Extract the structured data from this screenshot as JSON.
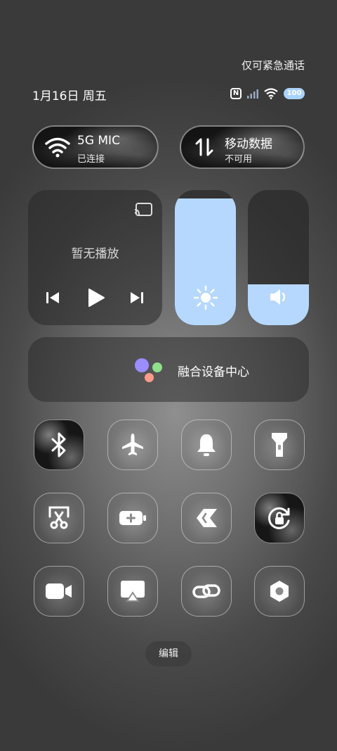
{
  "status": {
    "emergency_text": "仅可紧急通话",
    "date_text": "1月16日 周五",
    "battery_text": "100"
  },
  "wifi_pill": {
    "ssid": "5G MIC",
    "state": "已连接",
    "icon": "wifi-icon"
  },
  "data_pill": {
    "title": "移动数据",
    "state": "不可用",
    "icon": "mobile-data-icon"
  },
  "media": {
    "no_playback": "暂无播放",
    "icons": [
      "cast-icon",
      "previous-icon",
      "play-icon",
      "next-icon"
    ]
  },
  "sliders": {
    "brightness_level": 0.94,
    "volume_level": 0.3
  },
  "fusion": {
    "label": "融合设备中心",
    "colors": [
      "#9b8cff",
      "#8fe08a",
      "#ff9a8a"
    ]
  },
  "toggles": [
    {
      "name": "bluetooth",
      "active": true
    },
    {
      "name": "airplane-mode",
      "active": false
    },
    {
      "name": "mute",
      "active": false
    },
    {
      "name": "flashlight",
      "active": false
    },
    {
      "name": "screenshot",
      "active": false
    },
    {
      "name": "battery-saver",
      "active": false
    },
    {
      "name": "nearby-share",
      "active": false
    },
    {
      "name": "rotation-lock",
      "active": true
    },
    {
      "name": "screen-recorder",
      "active": false
    },
    {
      "name": "screen-cast",
      "active": false
    },
    {
      "name": "link",
      "active": false
    },
    {
      "name": "settings",
      "active": false
    }
  ],
  "edit_label": "编辑",
  "accent_color": "#b6d8ff"
}
